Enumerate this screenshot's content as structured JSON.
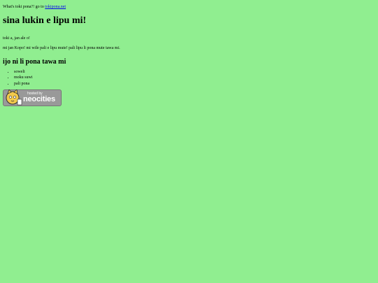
{
  "intro": {
    "prefix": "What's toki pona?! go to",
    "link_text": "tokipona.net"
  },
  "heading": "sina lukin e lipu mi!",
  "paragraphs": [
    "toki a, jan ale o!",
    "mi jan Kopo! mi wile pali e lipu mute! pali lipu li pona mute tawa mi."
  ],
  "subheading": "ijo ni li pona tawa mi",
  "list_items": [
    "soweli",
    "moku suwi",
    "pali pona"
  ],
  "badge": {
    "top_text": "hosted by",
    "main_text": "neocities"
  }
}
